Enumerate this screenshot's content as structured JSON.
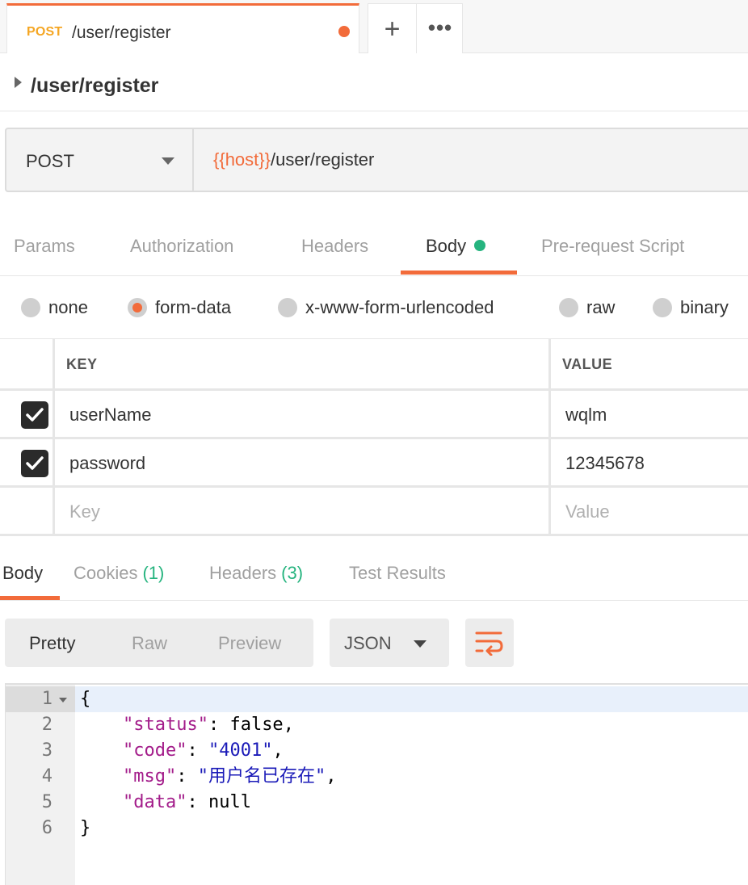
{
  "tab": {
    "method": "POST",
    "title": "/user/register"
  },
  "tab_buttons": {
    "new_icon": "plus-icon",
    "more_icon": "ellipsis-icon"
  },
  "request": {
    "name": "/user/register",
    "method": "POST",
    "url_var": "{{host}}",
    "url_path": "/user/register"
  },
  "request_tabs": [
    {
      "label": "Params"
    },
    {
      "label": "Authorization"
    },
    {
      "label": "Headers"
    },
    {
      "label": "Body"
    },
    {
      "label": "Pre-request Script"
    }
  ],
  "body_types": [
    {
      "label": "none",
      "selected": false
    },
    {
      "label": "form-data",
      "selected": true
    },
    {
      "label": "x-www-form-urlencoded",
      "selected": false
    },
    {
      "label": "raw",
      "selected": false
    },
    {
      "label": "binary",
      "selected": false
    }
  ],
  "kv_table": {
    "headers": [
      "KEY",
      "VALUE"
    ],
    "rows": [
      {
        "checked": true,
        "key": "userName",
        "value": "wqlm"
      },
      {
        "checked": true,
        "key": "password",
        "value": "12345678"
      }
    ],
    "placeholder_key": "Key",
    "placeholder_value": "Value"
  },
  "response_tabs": [
    {
      "label": "Body"
    },
    {
      "label": "Cookies",
      "count": "(1)"
    },
    {
      "label": "Headers",
      "count": "(3)"
    },
    {
      "label": "Test Results"
    }
  ],
  "response_toolbar": {
    "views": [
      "Pretty",
      "Raw",
      "Preview"
    ],
    "format": "JSON",
    "wrap_icon": "wrap-lines-icon"
  },
  "response_body": {
    "line_numbers": [
      "1",
      "2",
      "3",
      "4",
      "5",
      "6"
    ],
    "open_brace": "{",
    "close_brace": "}",
    "fields": [
      {
        "key": "\"status\"",
        "value": "false",
        "trail": ","
      },
      {
        "key": "\"code\"",
        "value": "\"4001\"",
        "trail": ","
      },
      {
        "key": "\"msg\"",
        "value": "\"用户名已存在\"",
        "trail": ","
      },
      {
        "key": "\"data\"",
        "value": "null",
        "trail": ""
      }
    ]
  },
  "colors": {
    "accent": "#f26b3a",
    "method_post": "#f5a623",
    "success_green": "#26b47f",
    "json_key": "#a31c8a",
    "json_string": "#1a1ab8"
  }
}
